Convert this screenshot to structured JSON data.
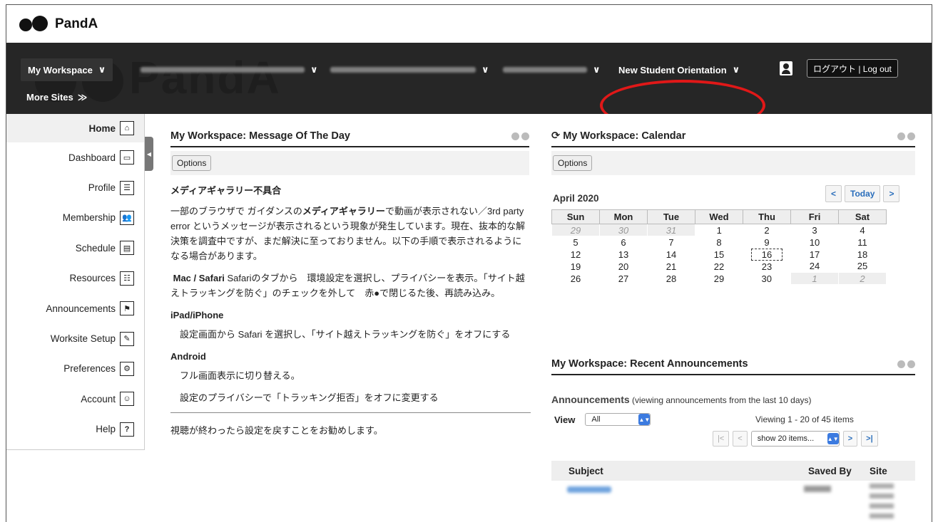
{
  "logo": {
    "text": "PandA"
  },
  "nav": {
    "sites": [
      {
        "label": "My Workspace",
        "blurred": false
      },
      {
        "label": "",
        "blurred": true
      },
      {
        "label": "",
        "blurred": true
      },
      {
        "label": "",
        "blurred": true
      },
      {
        "label": "New Student Orientation",
        "blurred": false
      }
    ],
    "more_sites": "More Sites",
    "logout": "ログアウト | Log out",
    "watermark": "PandA"
  },
  "sidebar": {
    "items": [
      {
        "label": "Home",
        "icon": "home-icon",
        "glyph": "⌂",
        "active": true
      },
      {
        "label": "Dashboard",
        "icon": "dashboard-icon",
        "glyph": "▭"
      },
      {
        "label": "Profile",
        "icon": "profile-icon",
        "glyph": "☰"
      },
      {
        "label": "Membership",
        "icon": "membership-icon",
        "glyph": "👥"
      },
      {
        "label": "Schedule",
        "icon": "schedule-icon",
        "glyph": "▤"
      },
      {
        "label": "Resources",
        "icon": "resources-icon",
        "glyph": "☷"
      },
      {
        "label": "Announcements",
        "icon": "announcements-icon",
        "glyph": "⚑"
      },
      {
        "label": "Worksite Setup",
        "icon": "worksite-setup-icon",
        "glyph": "✎"
      },
      {
        "label": "Preferences",
        "icon": "preferences-icon",
        "glyph": "⚙"
      },
      {
        "label": "Account",
        "icon": "account-icon",
        "glyph": "☺"
      },
      {
        "label": "Help",
        "icon": "help-icon",
        "glyph": "?"
      }
    ]
  },
  "motd": {
    "title": "My Workspace: Message Of The Day",
    "options": "Options",
    "heading": "メディアギャラリー不具合",
    "p1_a": "一部のブラウザで ガイダンスの",
    "p1_bold": "メディアギャラリー",
    "p1_b": "で動画が表示されない／3rd party error というメッセージが表示されるという現象が発生しています。現在、抜本的な解決策を調査中ですが、まだ解決に至っておりません。以下の手順で表示されるようになる場合があります。",
    "mac_bold": "Mac / Safari",
    "mac_text": " Safariのタブから　環境設定を選択し、プライバシーを表示。「サイト越えトラッキングを防ぐ」のチェックを外して　赤●で閉じるた後、再読み込み。",
    "ipad_head": "iPad/iPhone",
    "ipad_text": "　設定画面から Safari を選択し、「サイト越えトラッキングを防ぐ」をオフにする",
    "android_head": "Android",
    "android_1": "　フル画面表示に切り替える。",
    "android_2": "　設定のプライバシーで「トラッキング拒否」をオフに変更する",
    "footer": "視聴が終わったら設定を戻すことをお勧めします。"
  },
  "calendar": {
    "title": "My Workspace: Calendar",
    "options": "Options",
    "month": "April 2020",
    "nav_prev": "<",
    "nav_today": "Today",
    "nav_next": ">",
    "days": [
      "Sun",
      "Mon",
      "Tue",
      "Wed",
      "Thu",
      "Fri",
      "Sat"
    ],
    "weeks": [
      [
        "29",
        "30",
        "31",
        "1",
        "2",
        "3",
        "4"
      ],
      [
        "5",
        "6",
        "7",
        "8",
        "9",
        "10",
        "11"
      ],
      [
        "12",
        "13",
        "14",
        "15",
        "16",
        "17",
        "18"
      ],
      [
        "19",
        "20",
        "21",
        "22",
        "23",
        "24",
        "25"
      ],
      [
        "26",
        "27",
        "28",
        "29",
        "30",
        "1",
        "2"
      ]
    ],
    "other_month": [
      [
        0,
        0
      ],
      [
        0,
        1
      ],
      [
        0,
        2
      ],
      [
        4,
        5
      ],
      [
        4,
        6
      ]
    ],
    "today": "16"
  },
  "announcements": {
    "title": "My Workspace: Recent Announcements",
    "sub_bold": "Announcements",
    "sub_text": " (viewing announcements from the last 10 days)",
    "view_label": "View",
    "view_value": "All",
    "viewing": "Viewing 1 - 20 of 45 items",
    "first": "|<",
    "prev": "<",
    "show": "show 20 items...",
    "next": ">",
    "last": ">|",
    "col_subject": "Subject",
    "col_saved_by": "Saved By",
    "col_site": "Site"
  }
}
